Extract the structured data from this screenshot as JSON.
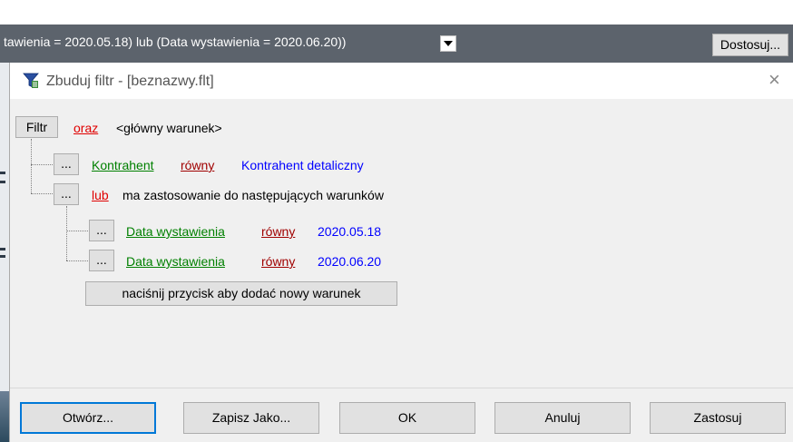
{
  "filterbar": {
    "expression": "tawienia = 2020.05.18) lub (Data wystawienia = 2020.06.20))",
    "customize_label": "Dostosuj..."
  },
  "dialog": {
    "title": "Zbuduj filtr - [beznazwy.flt]",
    "close_icon": "×"
  },
  "tree": {
    "root_button": "Filtr",
    "root_operator": "oraz",
    "root_text": "<główny warunek>",
    "ellipsis": "...",
    "cond1": {
      "field": "Kontrahent",
      "operator": "równy",
      "value": "Kontrahent detaliczny"
    },
    "group": {
      "operator": "lub",
      "text": "ma zastosowanie do następujących warunków"
    },
    "cond2": {
      "field": "Data wystawienia",
      "operator": "równy",
      "value": "2020.05.18"
    },
    "cond3": {
      "field": "Data wystawienia",
      "operator": "równy",
      "value": "2020.06.20"
    },
    "add_button": "naciśnij przycisk aby dodać nowy warunek"
  },
  "buttons": {
    "open": "Otwórz...",
    "save_as": "Zapisz Jako...",
    "ok": "OK",
    "cancel": "Anuluj",
    "apply": "Zastosuj"
  },
  "colors": {
    "operator": "#e00000",
    "field": "#008000",
    "comparison": "#a00000",
    "value": "#0000ff",
    "filterbar_bg": "#5c636c"
  }
}
